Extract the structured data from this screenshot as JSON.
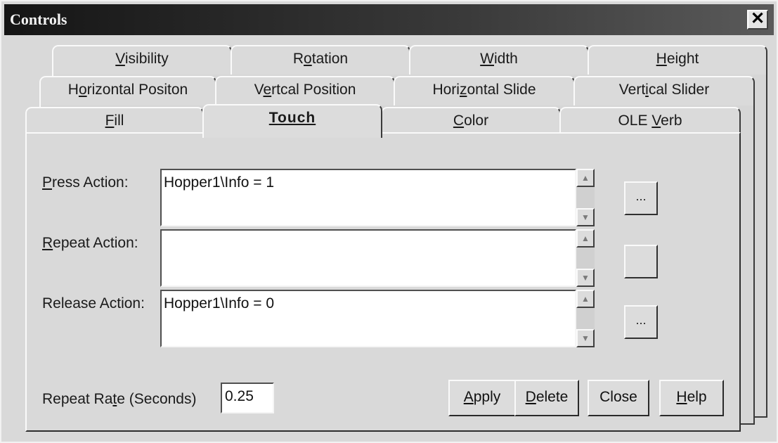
{
  "window": {
    "title": "Controls",
    "close_glyph": "✕"
  },
  "tabs": {
    "row1": [
      {
        "pre": "",
        "u": "V",
        "post": "isibility"
      },
      {
        "pre": "R",
        "u": "o",
        "post": "tation"
      },
      {
        "pre": "",
        "u": "W",
        "post": "idth"
      },
      {
        "pre": "",
        "u": "H",
        "post": "eight"
      }
    ],
    "row2": [
      {
        "pre": "H",
        "u": "o",
        "post": "rizontal Positon"
      },
      {
        "pre": "V",
        "u": "e",
        "post": "rtcal Position"
      },
      {
        "pre": "Hori",
        "u": "z",
        "post": "ontal Slide"
      },
      {
        "pre": "Vert",
        "u": "i",
        "post": "cal Slider"
      }
    ],
    "row3": [
      {
        "pre": "",
        "u": "F",
        "post": "ill"
      },
      {
        "pre": "",
        "u": "T",
        "post": "ouch"
      },
      {
        "pre": "",
        "u": "C",
        "post": "olor"
      },
      {
        "pre": "OLE ",
        "u": "V",
        "post": "erb"
      }
    ]
  },
  "form": {
    "press": {
      "label_u": "P",
      "label_rest": "ress Action:",
      "value": "Hopper1\\Info = 1"
    },
    "repeat": {
      "label_u": "R",
      "label_rest": "epeat Action:",
      "value": ""
    },
    "release": {
      "label_u": "",
      "label_rest": "Release Action:",
      "value": "Hopper1\\Info = 0"
    },
    "ellipsis": "...",
    "rate_label_pre": "Repeat Ra",
    "rate_label_u": "t",
    "rate_label_post": "e (Seconds)",
    "rate_value": "0.25"
  },
  "buttons": {
    "apply": {
      "u": "A",
      "rest": "pply"
    },
    "delete": {
      "u": "D",
      "rest": "elete"
    },
    "close": {
      "u": "",
      "rest": "Close"
    },
    "help": {
      "u": "H",
      "rest": "elp"
    }
  },
  "icons": {
    "scroll_up": "▲",
    "scroll_down": "▼",
    "close": "close-icon"
  }
}
